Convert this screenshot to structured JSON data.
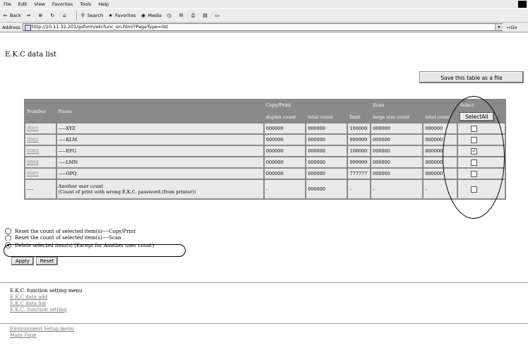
{
  "browser": {
    "menu": [
      "File",
      "Edit",
      "View",
      "Favorites",
      "Tools",
      "Help"
    ],
    "toolbar": {
      "back": "Back",
      "search": "Search",
      "favorites": "Favorites",
      "media": "Media"
    },
    "address_label": "Address",
    "address_value": "http://10.11.32.201/gsform/ekcfunc_en.html?PageType=list",
    "go_label": "Go"
  },
  "page": {
    "title": "E.K.C data list",
    "save_button": "Save this table as a file",
    "table": {
      "headers": {
        "number": "Number",
        "name": "Name",
        "copy_print": "Copy/Print",
        "scan": "Scan",
        "select": "Select",
        "duplex_count": "duplex count",
        "total_count": "total count",
        "limit": "limit",
        "large_size_count": "large size count",
        "scan_total": "total count",
        "select_all": "SelectAll"
      },
      "rows": [
        {
          "number": "0001",
          "name": "-----XYZ",
          "duplex": "000000",
          "total": "000000",
          "limit": "100000",
          "large": "000000",
          "scan_total": "000000",
          "checked": "false"
        },
        {
          "number": "0002",
          "name": "-----KLM",
          "duplex": "000000",
          "total": "000000",
          "limit": "999999",
          "large": "000000",
          "scan_total": "000000",
          "checked": "false"
        },
        {
          "number": "0003",
          "name": "-----EFG",
          "duplex": "000000",
          "total": "000000",
          "limit": "100000",
          "large": "000000",
          "scan_total": "000000",
          "checked": "true"
        },
        {
          "number": "0004",
          "name": "-----LMN",
          "duplex": "000000",
          "total": "000000",
          "limit": "999999",
          "large": "000000",
          "scan_total": "000000",
          "checked": "false"
        },
        {
          "number": "0005",
          "name": "-----OPQ",
          "duplex": "000000",
          "total": "000000",
          "limit": "777777",
          "large": "000000",
          "scan_total": "000000",
          "checked": "false"
        }
      ],
      "other_row": {
        "number": "----",
        "name_line1": "Another user count",
        "name_line2": "(Count of print with wrong E.K.C. password.(from printer))",
        "duplex": "-",
        "total": "000000",
        "limit": "-",
        "large": "-",
        "scan_total": "-"
      }
    },
    "options": [
      {
        "label": "Reset the count of selected item(s)----Copy/Print",
        "selected": "false"
      },
      {
        "label": "Reset the count of selected item(s)----Scan",
        "selected": "false"
      },
      {
        "label": "Delete selected item(s) (Except for Another user count)",
        "selected": "true"
      }
    ],
    "apply_button": "Apply",
    "reset_button": "Reset",
    "menu_heading": "E.K.C. function setting menu",
    "menu_links": [
      "E.K.C data add",
      "E.K.C data list",
      "E.K.C. function setting"
    ],
    "bottom_links": [
      "Environment Setup menu",
      "Main Page"
    ]
  }
}
